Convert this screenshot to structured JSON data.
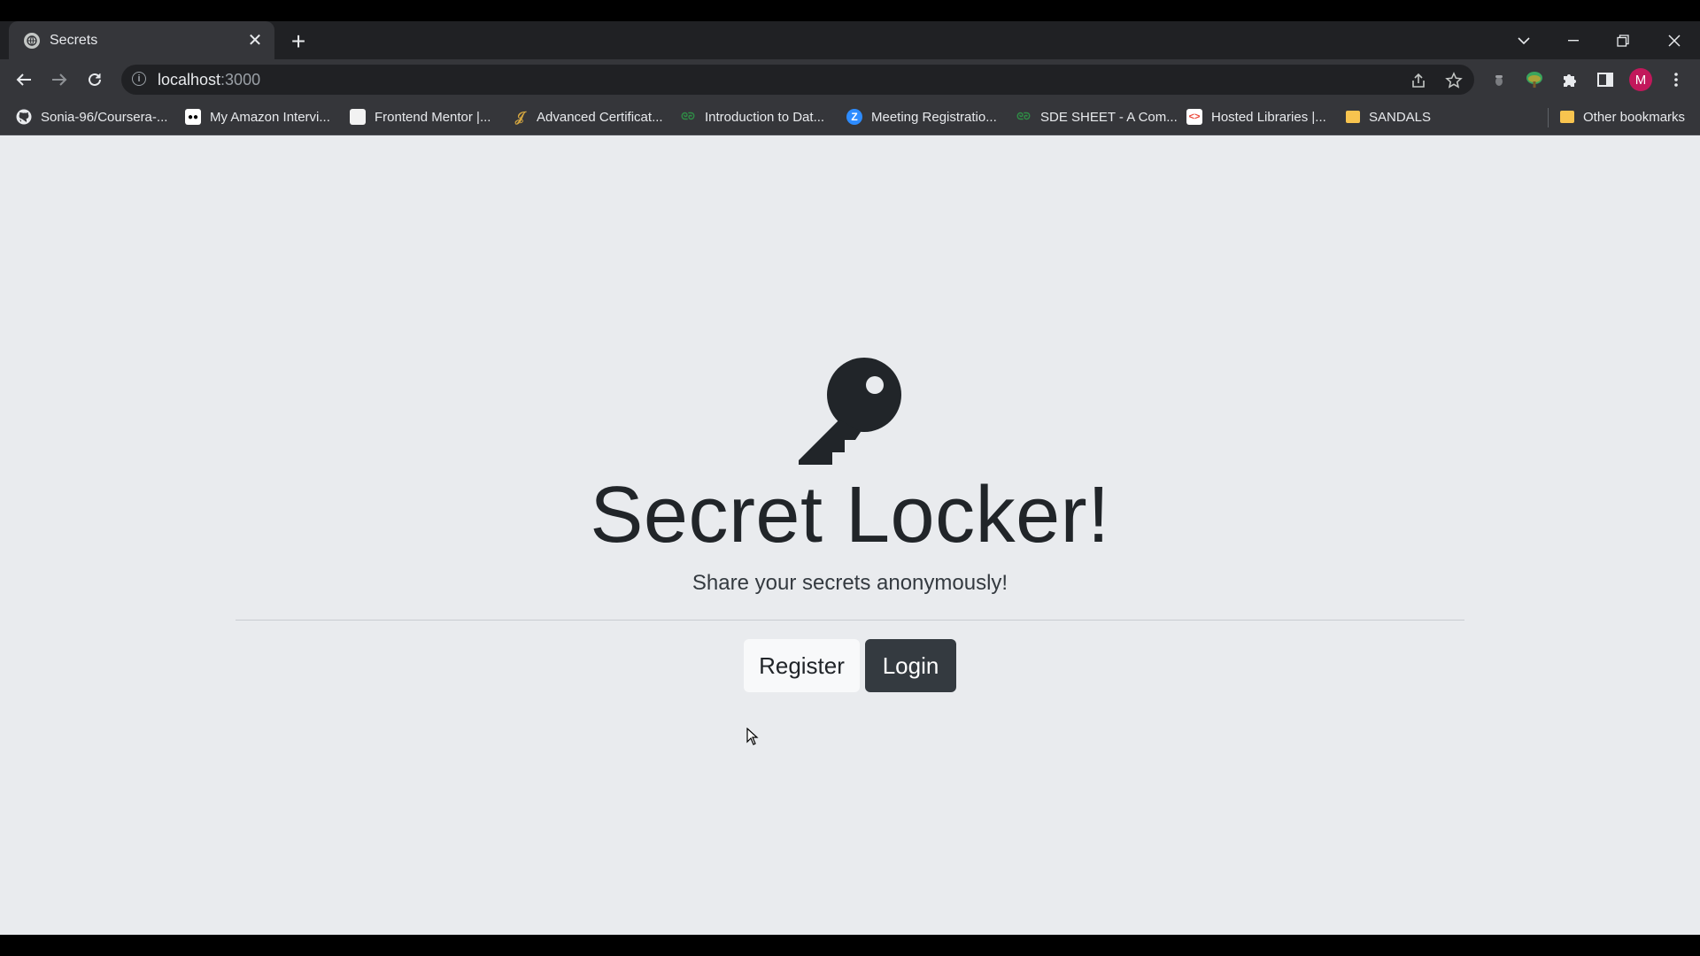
{
  "browser": {
    "tab": {
      "title": "Secrets",
      "close": "✕"
    },
    "new_tab": "+",
    "url": {
      "host": "localhost",
      "port": ":3000"
    },
    "profile_initial": "M"
  },
  "bookmarks": [
    {
      "label": "Sonia-96/Coursera-...",
      "icon": "github-icon"
    },
    {
      "label": "My Amazon Intervi...",
      "icon": "medium-icon"
    },
    {
      "label": "Frontend Mentor |...",
      "icon": "frontend-mentor-icon"
    },
    {
      "label": "Advanced Certificat...",
      "icon": "certificate-icon"
    },
    {
      "label": "Introduction to Dat...",
      "icon": "geeksforgeeks-icon"
    },
    {
      "label": "Meeting Registratio...",
      "icon": "zoom-icon"
    },
    {
      "label": "SDE SHEET - A Com...",
      "icon": "geeksforgeeks-icon"
    },
    {
      "label": "Hosted Libraries |...",
      "icon": "google-developers-icon"
    },
    {
      "label": "SANDALS",
      "icon": "folder-icon"
    }
  ],
  "other_bookmarks": "Other bookmarks",
  "page": {
    "title": "Secret Locker!",
    "lead": "Share your secrets anonymously!",
    "register": "Register",
    "login": "Login"
  },
  "colors": {
    "page_bg": "#e9ebee",
    "btn_dark": "#343a40",
    "btn_light": "#f8f9fa",
    "text": "#212529",
    "avatar": "#c2185b"
  }
}
